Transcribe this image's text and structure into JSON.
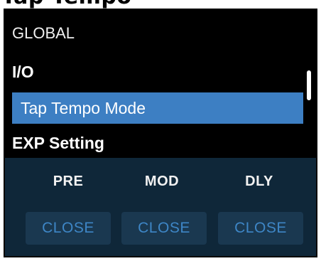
{
  "header": {
    "cropped_title": "Tap Tempo"
  },
  "menu": {
    "items": [
      {
        "label": "GLOBAL"
      },
      {
        "label": "I/O"
      },
      {
        "label": "Tap Tempo Mode",
        "selected": true
      },
      {
        "label": "EXP Setting"
      }
    ]
  },
  "modules": [
    {
      "label": "PRE",
      "button": "CLOSE"
    },
    {
      "label": "MOD",
      "button": "CLOSE"
    },
    {
      "label": "DLY",
      "button": "CLOSE"
    }
  ],
  "colors": {
    "selection": "#3d7fc3",
    "panel_bg": "#0f2739",
    "button_bg": "#1a3850",
    "button_text": "#3e86c6"
  }
}
